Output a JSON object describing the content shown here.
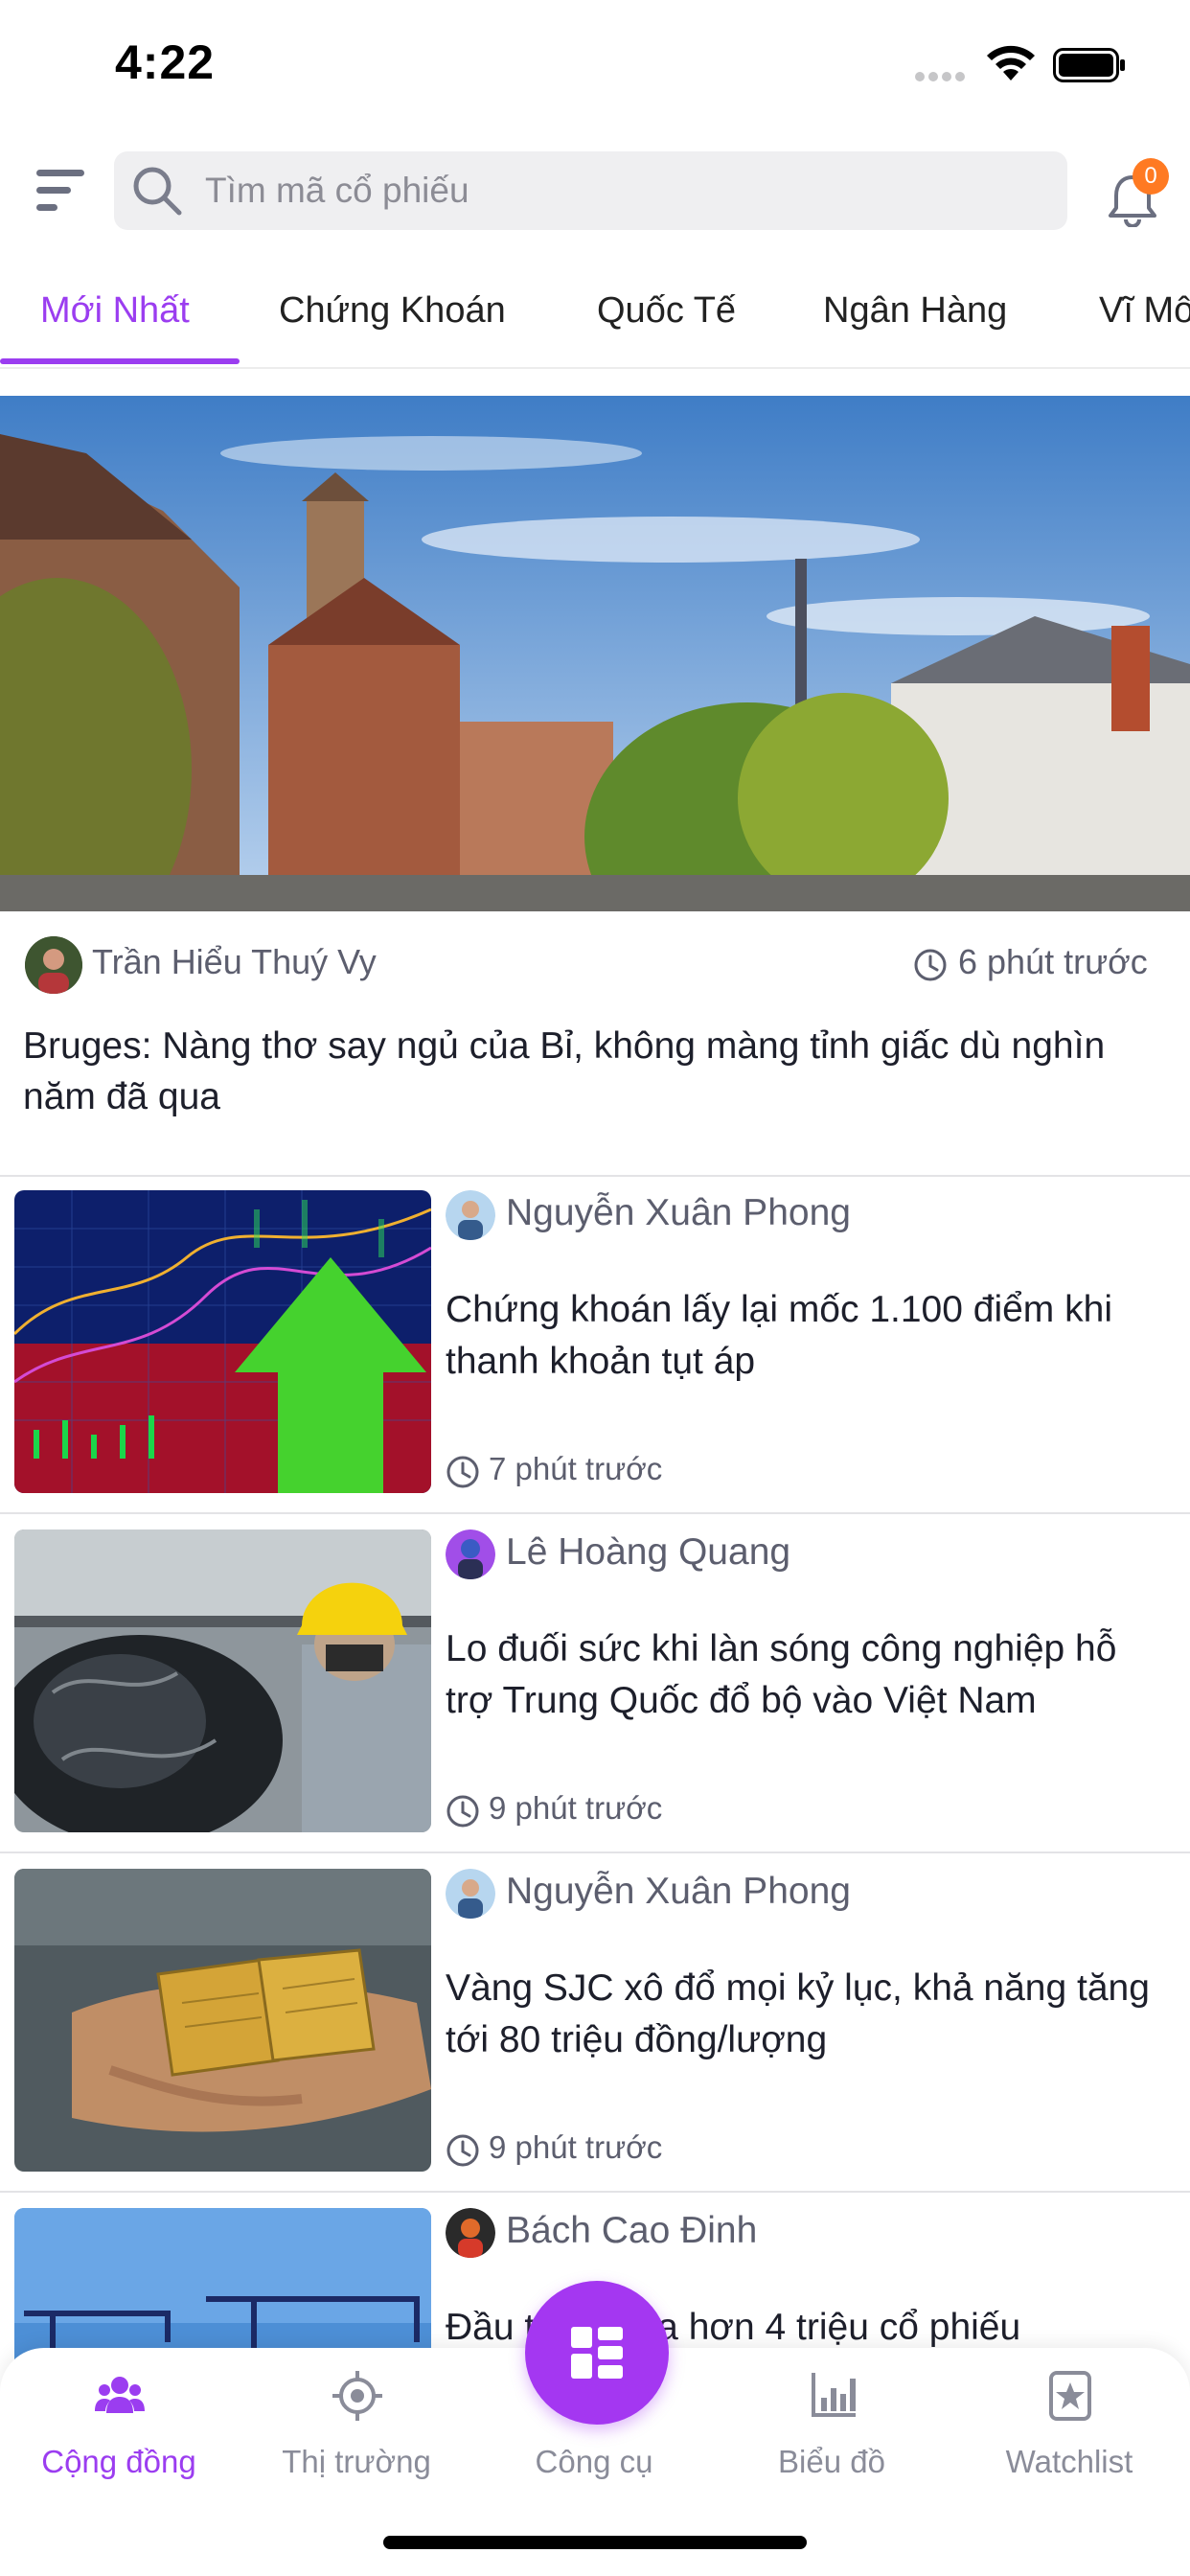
{
  "status_bar": {
    "time": "4:22"
  },
  "header": {
    "search_placeholder": "Tìm mã cổ phiếu",
    "notification_count": "0"
  },
  "tabs": [
    {
      "label": "Mới Nhất",
      "active": true
    },
    {
      "label": "Chứng Khoán"
    },
    {
      "label": "Quốc Tế"
    },
    {
      "label": "Ngân Hàng"
    },
    {
      "label": "Vĩ Mô"
    }
  ],
  "hero": {
    "author": "Trần Hiểu Thuý Vy",
    "time": "6 phút trước",
    "title": "Bruges: Nàng thơ say ngủ của Bỉ, không màng tỉnh giấc dù nghìn năm đã qua"
  },
  "articles": [
    {
      "author": "Nguyễn Xuân Phong",
      "title": "Chứng khoán lấy lại mốc 1.100 điểm khi thanh khoản tụt áp",
      "time": "7 phút trước",
      "thumb": "stock-chart"
    },
    {
      "author": "Lê Hoàng Quang",
      "title": "Lo đuối sức khi làn sóng công nghiệp hỗ trợ Trung Quốc đổ bộ vào Việt Nam",
      "time": "9 phút trước",
      "thumb": "factory-worker"
    },
    {
      "author": "Nguyễn Xuân Phong",
      "title": "Vàng SJC xô đổ mọi kỷ lục, khả năng tăng tới 80 triệu đồng/lượng",
      "time": "9 phút trước",
      "thumb": "gold-bars"
    },
    {
      "author": "Bách Cao Đinh",
      "title": "Đầu tư Á mua hơn 4 triệu cổ phiếu",
      "time": "",
      "thumb": "port-cranes"
    }
  ],
  "bottom_nav": [
    {
      "label": "Cộng đồng",
      "icon": "community-icon",
      "active": true
    },
    {
      "label": "Thị trường",
      "icon": "market-icon"
    },
    {
      "label": "Công cụ",
      "icon": "tools-icon"
    },
    {
      "label": "Biểu đồ",
      "icon": "chart-icon"
    },
    {
      "label": "Watchlist",
      "icon": "watchlist-icon"
    }
  ],
  "colors": {
    "accent": "#9b3df0",
    "badge": "#ff7a22",
    "muted": "#5c5e6e"
  }
}
